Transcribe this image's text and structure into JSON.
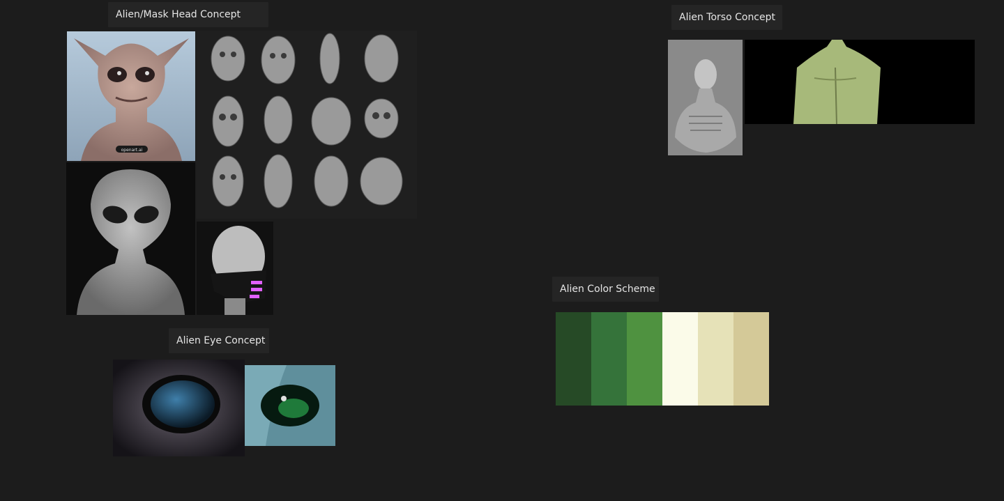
{
  "boards": {
    "head_label": "Alien/Mask Head Concept",
    "torso_label": "Alien Torso Concept",
    "eye_label": "Alien Eye Concept",
    "color_label": "Alien Color Scheme"
  },
  "watermark": "openart.ai",
  "palette": [
    "#264a26",
    "#35733a",
    "#4f9240",
    "#fbfbe9",
    "#e6e2b8",
    "#d4c998"
  ]
}
